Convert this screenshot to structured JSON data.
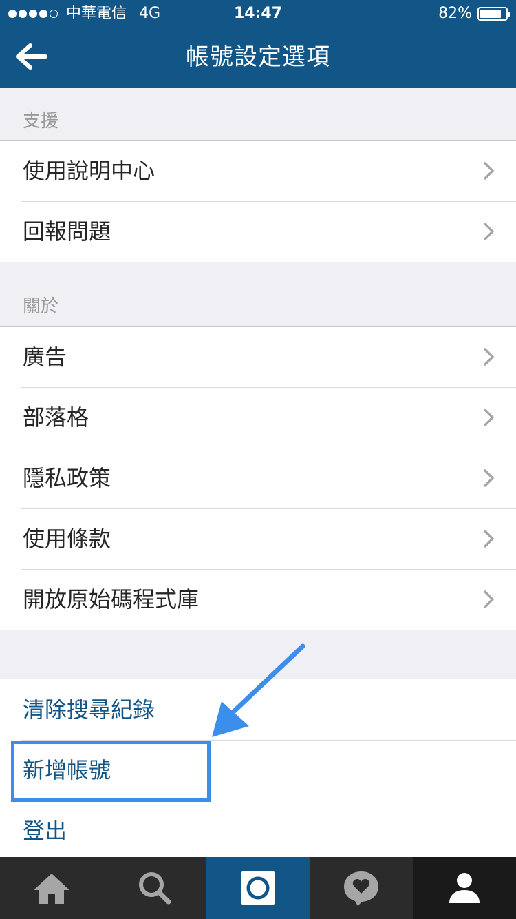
{
  "status_bar": {
    "carrier": "中華電信",
    "network": "4G",
    "time": "14:47",
    "battery": "82%",
    "battery_level": 0.82
  },
  "nav": {
    "title": "帳號設定選項",
    "back_icon": "back-arrow-icon"
  },
  "sections": {
    "support": {
      "header": "支援",
      "items": [
        "使用說明中心",
        "回報問題"
      ]
    },
    "about": {
      "header": "關於",
      "items": [
        "廣告",
        "部落格",
        "隱私政策",
        "使用條款",
        "開放原始碼程式庫"
      ]
    },
    "actions": {
      "items": [
        "清除搜尋紀錄",
        "新增帳號",
        "登出"
      ]
    }
  },
  "tabbar": {
    "tabs": [
      "home-icon",
      "search-icon",
      "camera-icon",
      "activity-heart-icon",
      "profile-icon"
    ],
    "active_tab": "profile-icon"
  },
  "colors": {
    "brand": "#125688",
    "annotation": "#3b8eea",
    "link_text": "#125688"
  }
}
